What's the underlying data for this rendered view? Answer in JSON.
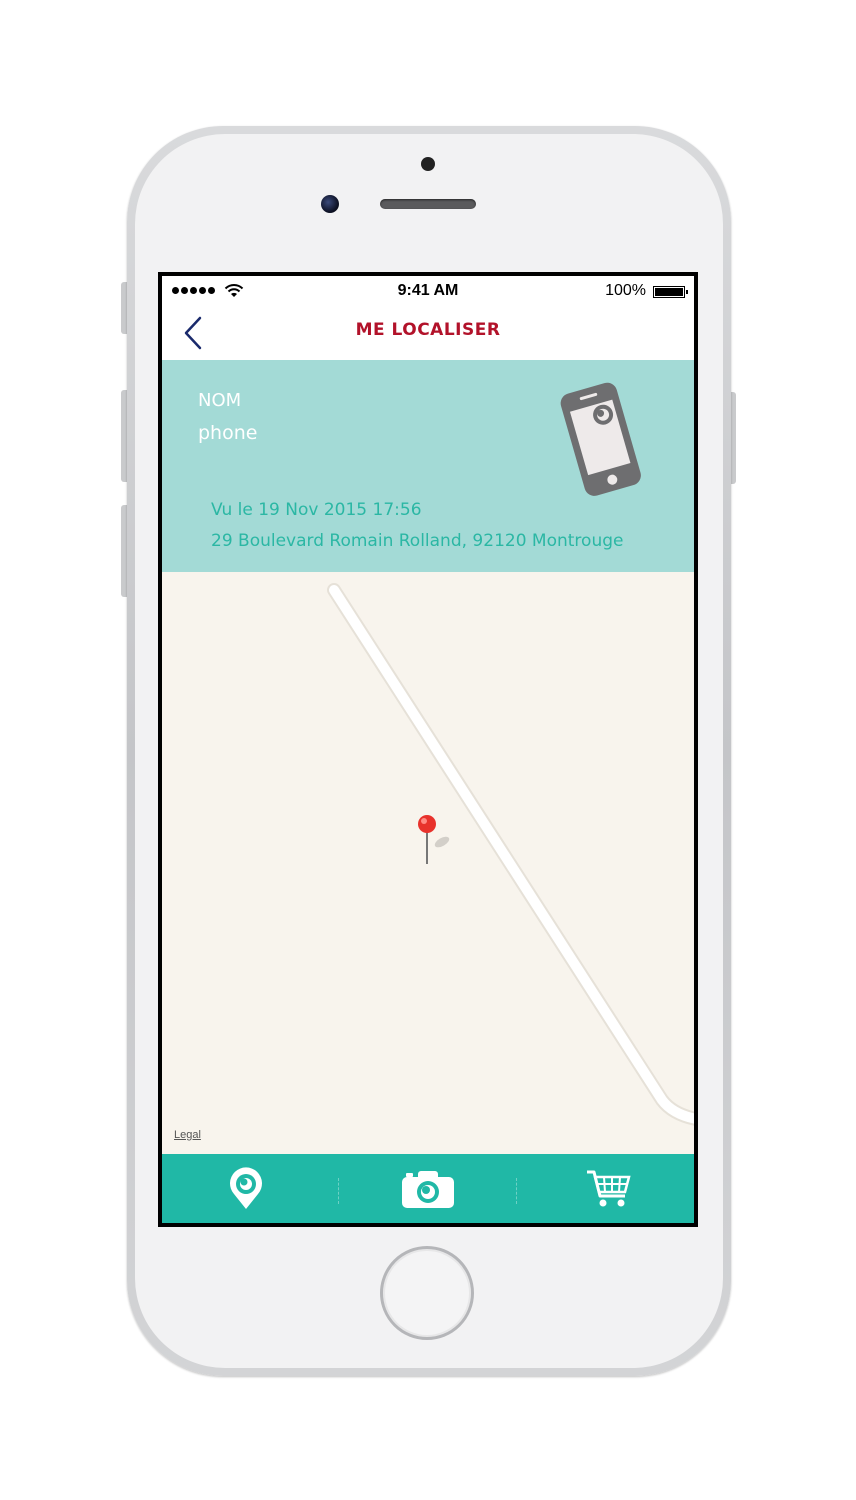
{
  "status_bar": {
    "time": "9:41 AM",
    "battery": "100%"
  },
  "nav": {
    "title": "ME LOCALISER",
    "back_icon": "chevron-left-icon"
  },
  "device_info": {
    "name_label": "NOM",
    "device_name": "phone",
    "last_seen": "Vu le 19 Nov 2015 17:56",
    "address": "29 Boulevard Romain Rolland, 92120 Montrouge",
    "icon": "smartphone-icon"
  },
  "map": {
    "legal_link": "Legal",
    "pin_icon": "map-pin-icon"
  },
  "tab_bar": {
    "items": [
      {
        "icon": "location-icon"
      },
      {
        "icon": "camera-icon"
      },
      {
        "icon": "cart-icon"
      }
    ]
  },
  "colors": {
    "accent": "#b2122a",
    "panel": "#a3dad6",
    "teal_text": "#2bb7a4",
    "tab_bar": "#20b8a6",
    "map_bg": "#f8f4ed"
  }
}
